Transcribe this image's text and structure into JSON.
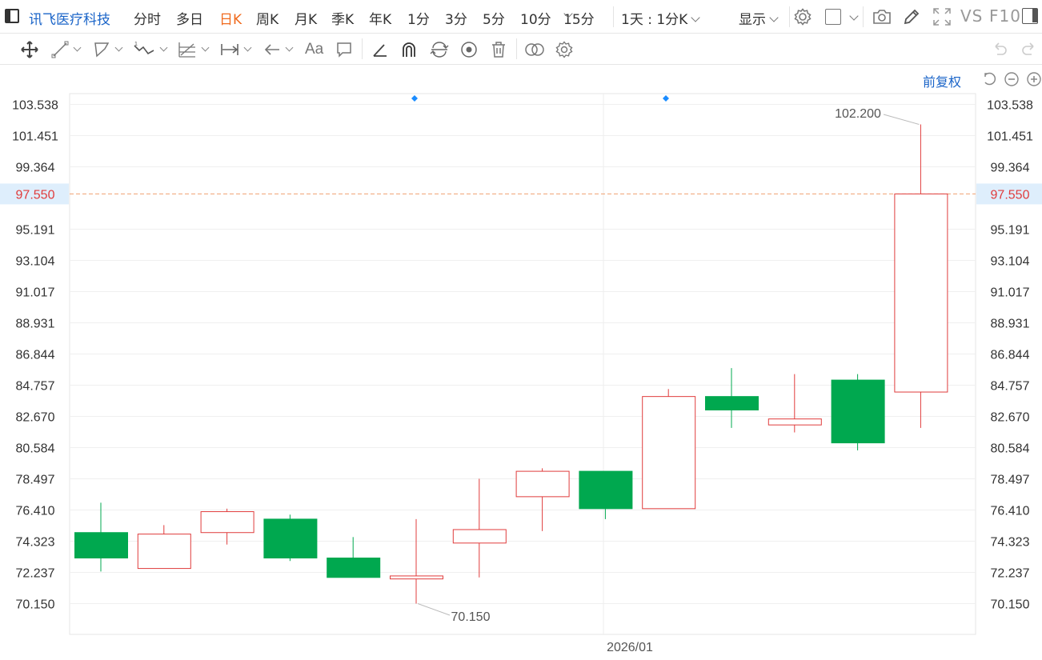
{
  "header": {
    "stock_name": "讯飞医疗科技",
    "periods": [
      "分时",
      "多日",
      "日K",
      "周K",
      "月K",
      "季K",
      "年K",
      "1分",
      "3分",
      "5分",
      "10分",
      "15分"
    ],
    "active_period": "日K",
    "intraday_label": "1天 : 1分K",
    "display_label": "显示",
    "vs_label": "VS",
    "f10_label": "F10"
  },
  "toolbar": {
    "text_tool": "Aa"
  },
  "adjust_label": "前复权",
  "chart_data": {
    "type": "candlestick",
    "y_ticks": [
      "103.538",
      "101.451",
      "99.364",
      "97.550",
      "95.191",
      "93.104",
      "91.017",
      "88.931",
      "86.844",
      "84.757",
      "82.670",
      "80.584",
      "78.497",
      "76.410",
      "74.323",
      "72.237",
      "70.150"
    ],
    "current_price": "97.550",
    "x_label": "2026/01",
    "max_label": "102.200",
    "min_label": "70.150",
    "up_color": "#e03c3c",
    "down_color": "#00a84f",
    "candles": [
      {
        "open": 74.9,
        "close": 73.2,
        "high": 76.9,
        "low": 72.3
      },
      {
        "open": 72.5,
        "close": 74.8,
        "high": 75.4,
        "low": 72.5
      },
      {
        "open": 74.9,
        "close": 76.3,
        "high": 76.5,
        "low": 74.1
      },
      {
        "open": 75.8,
        "close": 73.2,
        "high": 76.1,
        "low": 73.0
      },
      {
        "open": 73.2,
        "close": 71.9,
        "high": 74.6,
        "low": 71.9
      },
      {
        "open": 71.8,
        "close": 72.0,
        "high": 75.8,
        "low": 70.15
      },
      {
        "open": 74.2,
        "close": 75.1,
        "high": 78.5,
        "low": 71.9
      },
      {
        "open": 77.3,
        "close": 79.0,
        "high": 79.2,
        "low": 75.0
      },
      {
        "open": 79.0,
        "close": 76.5,
        "high": 79.0,
        "low": 75.8
      },
      {
        "open": 76.5,
        "close": 84.0,
        "high": 84.5,
        "low": 76.5
      },
      {
        "open": 84.0,
        "close": 83.1,
        "high": 85.9,
        "low": 81.9
      },
      {
        "open": 82.1,
        "close": 82.5,
        "high": 85.5,
        "low": 81.6
      },
      {
        "open": 85.1,
        "close": 80.9,
        "high": 85.5,
        "low": 80.4
      },
      {
        "open": 84.3,
        "close": 97.55,
        "high": 102.2,
        "low": 81.9
      }
    ]
  }
}
